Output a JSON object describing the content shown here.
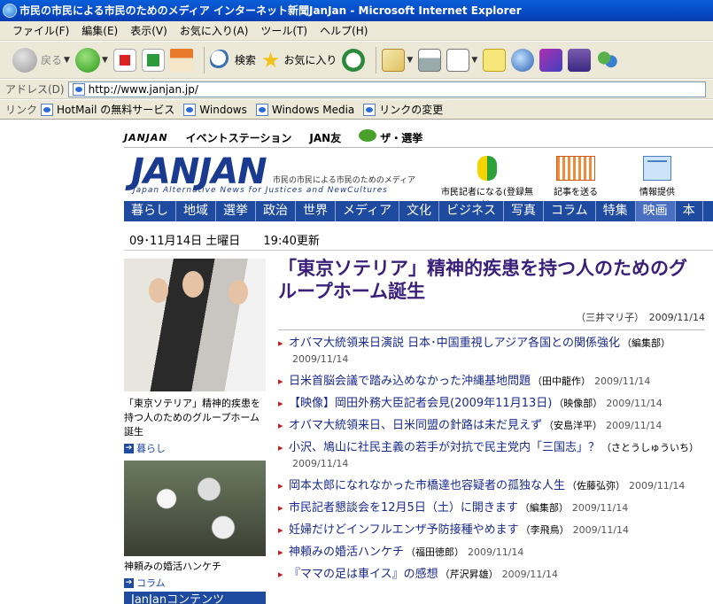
{
  "window": {
    "title": "市民の市民による市民のためのメディア インターネット新聞JanJan - Microsoft Internet Explorer"
  },
  "menubar": {
    "items": [
      "ファイル(F)",
      "編集(E)",
      "表示(V)",
      "お気に入り(A)",
      "ツール(T)",
      "ヘルプ(H)"
    ]
  },
  "toolbar": {
    "back": "戻る",
    "search": "検索",
    "favorites": "お気に入り"
  },
  "address": {
    "label": "アドレス(D)",
    "url": "http://www.janjan.jp/"
  },
  "links": {
    "label": "リンク",
    "items": [
      "HotMail の無料サービス",
      "Windows",
      "Windows Media",
      "リンクの変更"
    ]
  },
  "site": {
    "topnav": {
      "logo": "JANJAN",
      "event": "イベントステーション",
      "friends": "JAN友",
      "election": "ザ・選挙"
    },
    "logo": {
      "main": "JANJAN",
      "tagline": "市民の市民による市民のためのメディア",
      "sub": "Japan Alternative News for Justices and NewCultures"
    },
    "actions": {
      "register": "市民記者になる(登録無料)",
      "send": "記事を送る",
      "info": "情報提供"
    },
    "categories": [
      "暮らし",
      "地域",
      "選挙",
      "政治",
      "世界",
      "メディア",
      "文化",
      "ビジネス",
      "写真",
      "コラム",
      "特集",
      "映画",
      "本"
    ],
    "active_category": "映画",
    "date": "09･11月14日 土曜日",
    "updated": "19:40更新"
  },
  "left": {
    "feature1": {
      "caption": "「東京ソテリア」精神的疾患を持つ人のためのグループホーム誕生",
      "category": "暮らし"
    },
    "feature2": {
      "caption": "神頼みの婚活ハンケチ",
      "category": "コラム"
    },
    "contents_header": "JanJanコンテンツ"
  },
  "main": {
    "headline": "「東京ソテリア」精神的疾患を持つ人のためのグループホーム誕生",
    "author": "（三井マリ子）",
    "date": "2009/11/14",
    "news": [
      {
        "title": "オバマ大統領来日演説 日本･中国重視しアジア各国との関係強化",
        "source": "（編集部）",
        "date": "2009/11/14"
      },
      {
        "title": "日米首脳会議で踏み込めなかった沖縄基地問題",
        "source": "（田中龍作）",
        "date": "2009/11/14"
      },
      {
        "title": "【映像】岡田外務大臣記者会見(2009年11月13日)",
        "source": "（映像部）",
        "date": "2009/11/14"
      },
      {
        "title": "オバマ大統領来日、日米同盟の針路は未だ見えず",
        "source": "（安島洋平）",
        "date": "2009/11/14"
      },
      {
        "title": "小沢、鳩山に社民主義の若手が対抗で民主党内「三国志」？",
        "source": "（さとうしゅういち）",
        "date": "2009/11/14"
      },
      {
        "title": "岡本太郎になれなかった市橋達也容疑者の孤独な人生",
        "source": "（佐藤弘弥）",
        "date": "2009/11/14"
      },
      {
        "title": "市民記者懇談会を12月5日（土）に開きます",
        "source": "（編集部）",
        "date": "2009/11/14"
      },
      {
        "title": "妊婦だけどインフルエンザ予防接種やめます",
        "source": "（李飛鳥）",
        "date": "2009/11/14"
      },
      {
        "title": "神頼みの婚活ハンケチ",
        "source": "（福田徳郎）",
        "date": "2009/11/14"
      },
      {
        "title": "『ママの足は車イス』の感想",
        "source": "（芹沢昇雄）",
        "date": "2009/11/14"
      }
    ]
  }
}
